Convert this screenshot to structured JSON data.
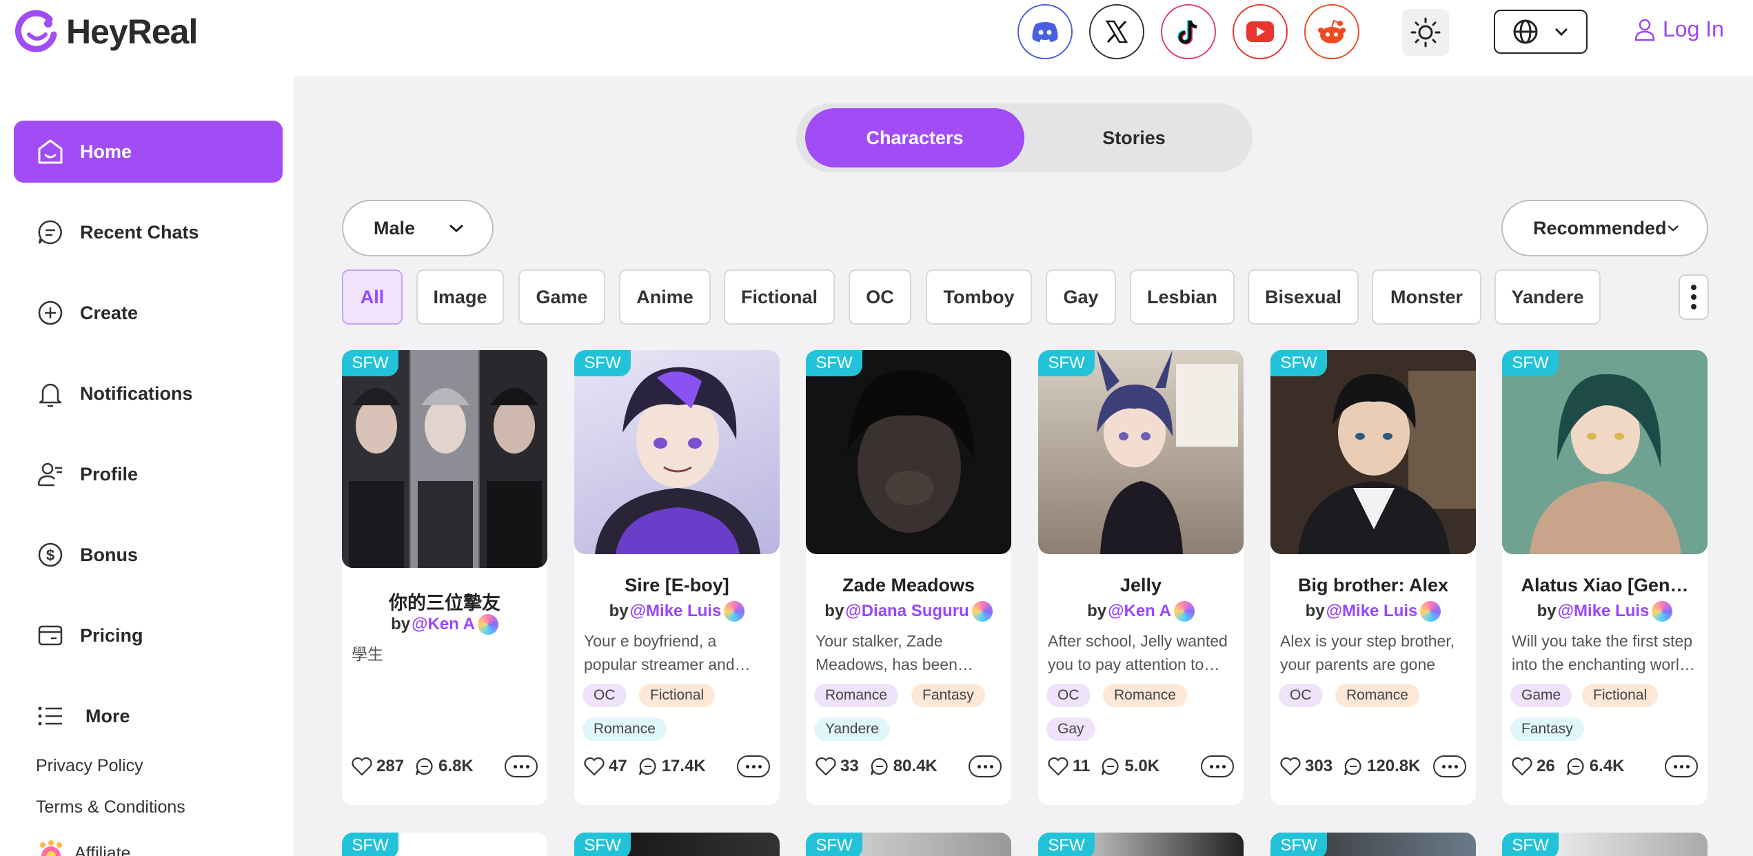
{
  "header": {
    "brand": "HeyReal",
    "login_label": "Log In",
    "social_icons": [
      "discord-icon",
      "x-icon",
      "tiktok-icon",
      "youtube-icon",
      "reddit-icon"
    ],
    "colors": {
      "accent": "#a24cf6",
      "link": "#9747ff",
      "sfw_badge": "#22c3d8"
    }
  },
  "sidebar": {
    "items": [
      {
        "label": "Home",
        "icon": "home-icon",
        "active": true
      },
      {
        "label": "Recent Chats",
        "icon": "chat-icon"
      },
      {
        "label": "Create",
        "icon": "plus-circle-icon"
      },
      {
        "label": "Notifications",
        "icon": "bell-icon"
      },
      {
        "label": "Profile",
        "icon": "user-icon"
      },
      {
        "label": "Bonus",
        "icon": "dollar-icon"
      },
      {
        "label": "Pricing",
        "icon": "card-icon"
      },
      {
        "label": "More",
        "icon": "list-icon"
      }
    ],
    "links": [
      "Privacy Policy",
      "Terms & Conditions",
      "Affiliate"
    ]
  },
  "main": {
    "tabs": [
      {
        "label": "Characters",
        "active": true
      },
      {
        "label": "Stories"
      }
    ],
    "gender_filter": "Male",
    "sort": "Recommended",
    "categories": [
      "All",
      "Image",
      "Game",
      "Anime",
      "Fictional",
      "OC",
      "Tomboy",
      "Gay",
      "Lesbian",
      "Bisexual",
      "Monster",
      "Yandere"
    ],
    "badge": "SFW",
    "by_prefix": "by",
    "cards": [
      {
        "name": "你的三位摯友",
        "author": "@Ken A",
        "desc": "學生",
        "tags": [],
        "likes": "287",
        "chats": "6.8K"
      },
      {
        "name": "Sire [E-boy]",
        "author": "@Mike Luis",
        "desc": "Your e boyfriend, a popular streamer and…",
        "tags": [
          "OC",
          "Fictional",
          "Romance"
        ],
        "likes": "47",
        "chats": "17.4K"
      },
      {
        "name": "Zade Meadows",
        "author": "@Diana Suguru",
        "desc": "Your stalker, Zade Meadows, has been…",
        "tags": [
          "Romance",
          "Fantasy",
          "Yandere"
        ],
        "likes": "33",
        "chats": "80.4K"
      },
      {
        "name": "Jelly",
        "author": "@Ken A",
        "desc": "After school, Jelly wanted you to pay attention to…",
        "tags": [
          "OC",
          "Romance",
          "Gay"
        ],
        "likes": "11",
        "chats": "5.0K"
      },
      {
        "name": "Big brother: Alex",
        "author": "@Mike Luis",
        "desc": "Alex is your step brother, your parents are gone fo…",
        "tags": [
          "OC",
          "Romance"
        ],
        "likes": "303",
        "chats": "120.8K"
      },
      {
        "name": "Alatus Xiao [Gen…",
        "author": "@Mike Luis",
        "desc": "Will you take the first step into the enchanting worl…",
        "tags": [
          "Game",
          "Fictional",
          "Fantasy"
        ],
        "likes": "26",
        "chats": "6.4K"
      }
    ]
  }
}
